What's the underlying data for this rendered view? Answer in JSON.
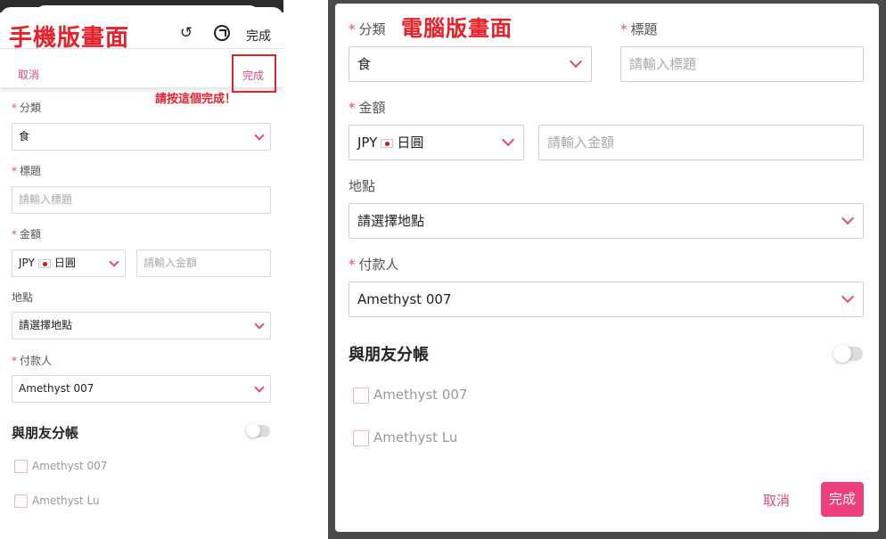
{
  "mobile": {
    "banner": "手機版畫面",
    "undo_icon": "undo-icon",
    "compass_icon": "compass-icon",
    "done_top": "完成",
    "cancel": "取消",
    "done": "完成",
    "hint": "請按這個完成！",
    "category_label": "分類",
    "category_value": "食",
    "title_label": "標題",
    "title_placeholder": "請輸入標題",
    "amount_label": "金額",
    "currency_code": "JPY",
    "currency_name": "日圓",
    "amount_placeholder": "請輸入金額",
    "location_label": "地點",
    "location_value": "請選擇地點",
    "payer_label": "付款人",
    "payer_value": "Amethyst 007",
    "split_title": "與朋友分帳",
    "friends": [
      "Amethyst 007",
      "Amethyst Lu"
    ]
  },
  "desktop": {
    "banner": "電腦版畫面",
    "category_label": "分類",
    "category_value": "食",
    "title_label": "標題",
    "title_placeholder": "請輸入標題",
    "amount_label": "金額",
    "currency_code": "JPY",
    "currency_name": "日圓",
    "amount_placeholder": "請輸入金額",
    "location_label": "地點",
    "location_value": "請選擇地點",
    "payer_label": "付款人",
    "payer_value": "Amethyst 007",
    "split_title": "與朋友分帳",
    "friends": [
      "Amethyst 007",
      "Amethyst Lu"
    ],
    "cancel": "取消",
    "done": "完成"
  },
  "colors": {
    "accent": "#e04a80",
    "annotation_red": "#e8202a",
    "primary_button": "#ec3f7c"
  }
}
